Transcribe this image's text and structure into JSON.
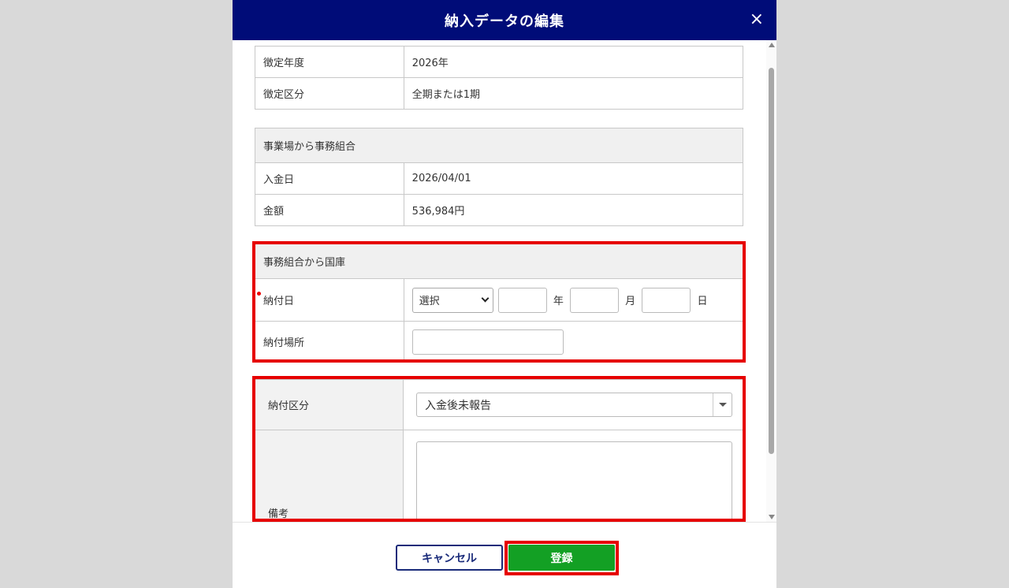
{
  "dialog": {
    "title": "納入データの編集",
    "close_symbol": "×"
  },
  "basic": {
    "rows": [
      {
        "label": "徴定年度",
        "value": "2026年"
      },
      {
        "label": "徴定区分",
        "value": "全期または1期"
      }
    ]
  },
  "office_to_union": {
    "section_title": "事業場から事務組合",
    "rows": [
      {
        "label": "入金日",
        "value": "2026/04/01"
      },
      {
        "label": "金額",
        "value": "536,984円"
      }
    ]
  },
  "union_to_treasury": {
    "section_title": "事務組合から国庫",
    "payment_date": {
      "label": "納付日",
      "era_select_value": "選択",
      "year_unit": "年",
      "month_unit": "月",
      "day_unit": "日"
    },
    "payment_place": {
      "label": "納付場所",
      "value": ""
    }
  },
  "status": {
    "payment_category_label": "納付区分",
    "payment_category_value": "入金後未報告",
    "remarks_label": "備考",
    "remarks_value": ""
  },
  "footer": {
    "cancel_label": "キャンセル",
    "submit_label": "登録"
  },
  "colors": {
    "header_bg": "#000c78",
    "highlight": "#e60000",
    "submit_bg": "#13a024",
    "cancel_border": "#1a2b7a"
  }
}
